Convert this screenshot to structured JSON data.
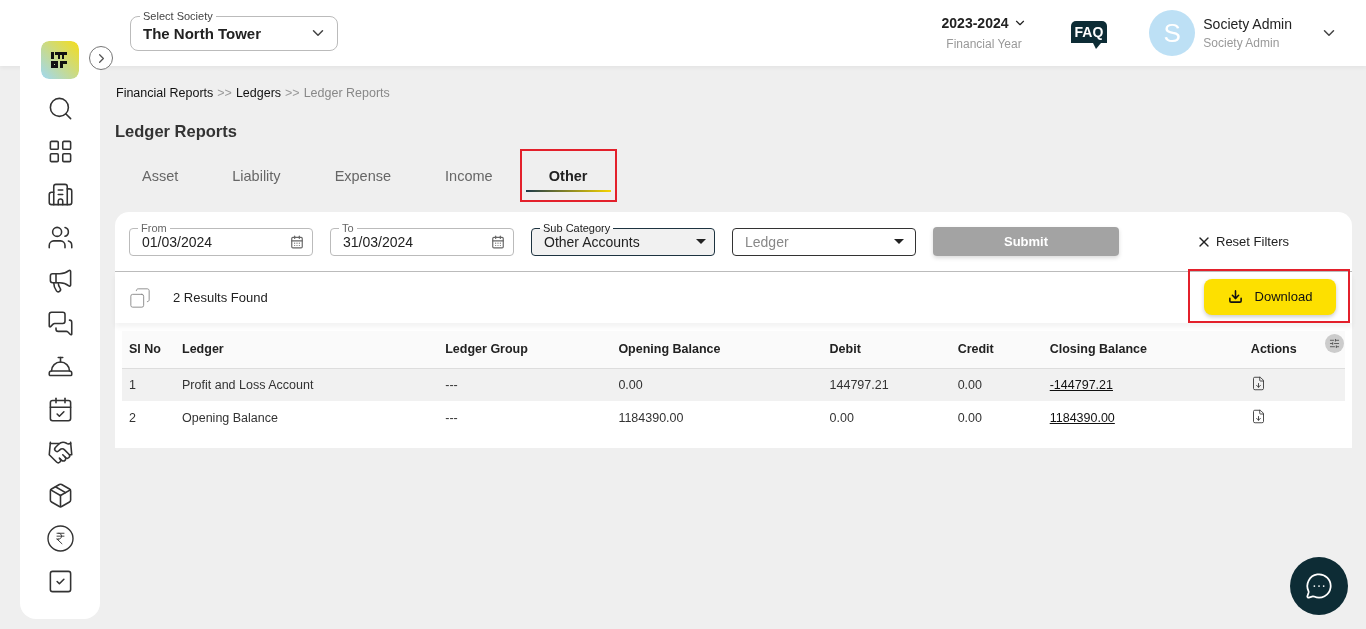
{
  "header": {
    "society_select": {
      "label": "Select Society",
      "value": "The North Tower"
    },
    "financial_year": {
      "value": "2023-2024",
      "label": "Financial Year"
    },
    "faq": "FAQ",
    "user": {
      "avatar_letter": "S",
      "name": "Society Admin",
      "role": "Society Admin"
    }
  },
  "breadcrumb": [
    {
      "text": "Financial Reports",
      "kind": "link"
    },
    {
      "text": ">>",
      "kind": "separator"
    },
    {
      "text": "Ledgers",
      "kind": "link"
    },
    {
      "text": ">>",
      "kind": "separator"
    },
    {
      "text": "Ledger Reports",
      "kind": "current"
    }
  ],
  "page_title": "Ledger Reports",
  "tabs": [
    {
      "label": "Asset",
      "selected": false,
      "highlighted": false
    },
    {
      "label": "Liability",
      "selected": false,
      "highlighted": false
    },
    {
      "label": "Expense",
      "selected": false,
      "highlighted": false
    },
    {
      "label": "Income",
      "selected": false,
      "highlighted": false
    },
    {
      "label": "Other",
      "selected": true,
      "highlighted": true
    }
  ],
  "filters": {
    "from": {
      "label": "From",
      "value": "01/03/2024"
    },
    "to": {
      "label": "To",
      "value": "31/03/2024"
    },
    "sub_category": {
      "label": "Sub Category",
      "value": "Other Accounts"
    },
    "ledger": {
      "placeholder": "Ledger"
    },
    "submit": {
      "label": "Submit",
      "disabled": true
    },
    "reset": "Reset Filters"
  },
  "results": "2 Results Found",
  "download": {
    "label": "Download",
    "highlighted": true
  },
  "table": {
    "columns": [
      "Sl No",
      "Ledger",
      "Ledger Group",
      "Opening Balance",
      "Debit",
      "Credit",
      "Closing Balance",
      "Actions"
    ],
    "rows": [
      {
        "cells": [
          "1",
          "Profit and Loss Account",
          "---",
          "0.00",
          "144797.21",
          "0.00",
          "-144797.21"
        ]
      },
      {
        "cells": [
          "2",
          "Opening Balance",
          "---",
          "1184390.00",
          "0.00",
          "0.00",
          "1184390.00"
        ]
      }
    ]
  }
}
